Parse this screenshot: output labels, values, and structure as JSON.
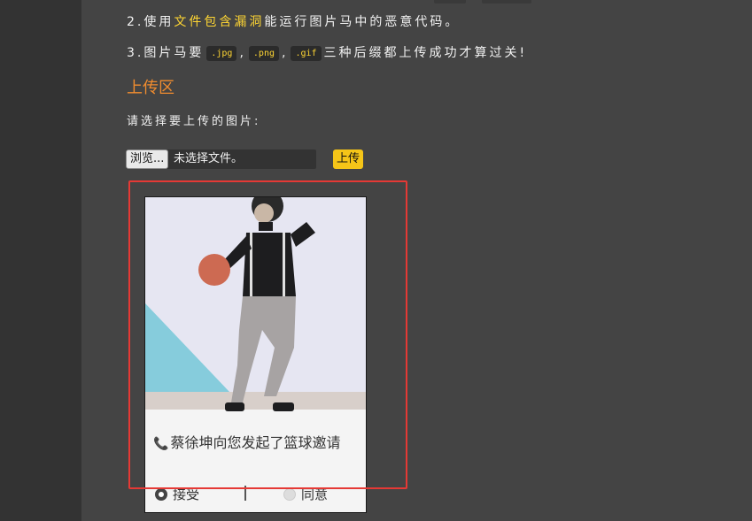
{
  "rules": {
    "line2": {
      "prefix": "2.使用",
      "highlight": "文件包含漏洞",
      "suffix": "能运行图片马中的恶意代码。"
    },
    "line3": {
      "prefix": "3.图片马要",
      "ext1": ".jpg",
      "sep1": ",",
      "ext2": ".png",
      "sep2": ",",
      "ext3": ".gif",
      "suffix": "三种后缀都上传成功才算过关!"
    }
  },
  "upload": {
    "section_title": "上传区",
    "prompt": "请选择要上传的图片:",
    "browse_label": "浏览...",
    "file_status": "未选择文件。",
    "upload_label": "上传"
  },
  "preview": {
    "caption_icon": "phone-icon",
    "caption": "蔡徐坤向您发起了篮球邀请",
    "accept_label": "接受",
    "agree_label": "同意"
  },
  "colors": {
    "background": "#444444",
    "highlight_text": "#ffd633",
    "section_title": "#f08c2f",
    "upload_button": "#f5c518",
    "annotation_border": "#e53935"
  }
}
